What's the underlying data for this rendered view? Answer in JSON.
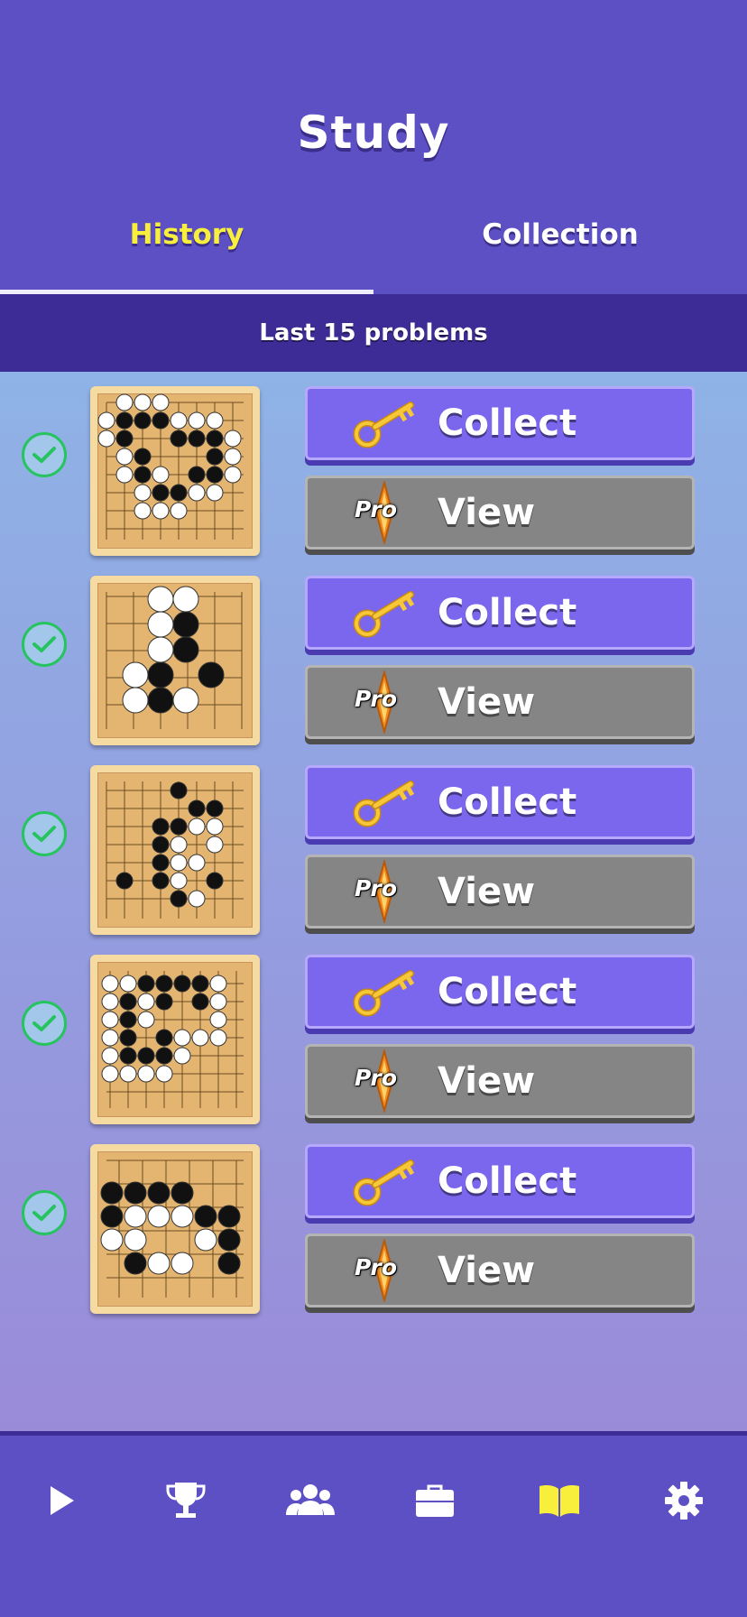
{
  "header": {
    "title": "Study"
  },
  "tabs": [
    {
      "label": "History",
      "active": true
    },
    {
      "label": "Collection",
      "active": false
    }
  ],
  "subheader": {
    "label": "Last 15 problems"
  },
  "problems": [
    {
      "status": "solved",
      "collect_label": "Collect",
      "view_label": "View",
      "view_badge": "Pro"
    },
    {
      "status": "solved",
      "collect_label": "Collect",
      "view_label": "View",
      "view_badge": "Pro"
    },
    {
      "status": "solved",
      "collect_label": "Collect",
      "view_label": "View",
      "view_badge": "Pro"
    },
    {
      "status": "solved",
      "collect_label": "Collect",
      "view_label": "View",
      "view_badge": "Pro"
    },
    {
      "status": "solved",
      "collect_label": "Collect",
      "view_label": "View",
      "view_badge": "Pro"
    }
  ],
  "nav": [
    {
      "icon": "play-icon",
      "active": false
    },
    {
      "icon": "trophy-icon",
      "active": false
    },
    {
      "icon": "friends-icon",
      "active": false
    },
    {
      "icon": "briefcase-icon",
      "active": false
    },
    {
      "icon": "book-icon",
      "active": true
    },
    {
      "icon": "gear-icon",
      "active": false
    }
  ],
  "colors": {
    "background": "#5d4fc4",
    "active_tab": "#f7ef3b",
    "collect_button": "#7b66ee",
    "view_button": "#858585",
    "check": "#25c45e",
    "board": "#e4b570"
  }
}
